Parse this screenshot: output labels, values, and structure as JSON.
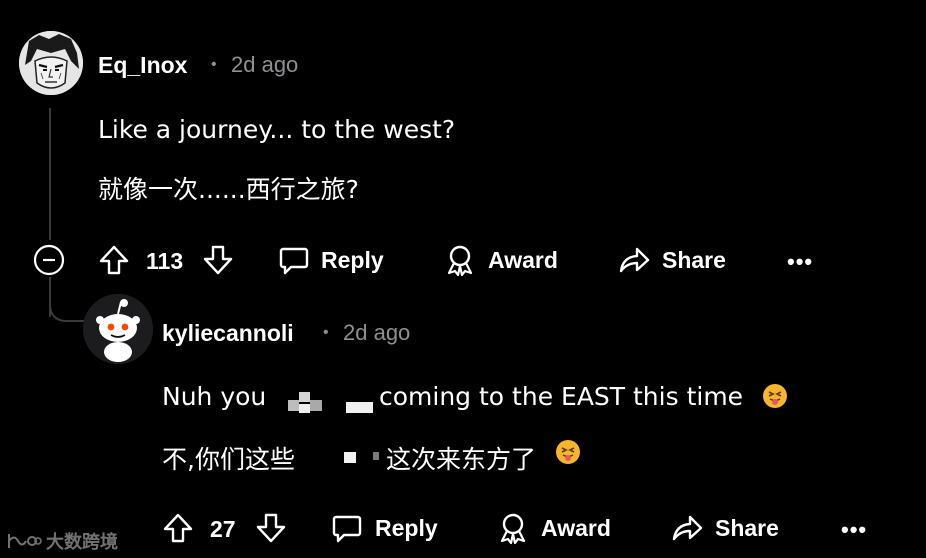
{
  "comment": {
    "username": "Eq_Inox",
    "separator": "•",
    "time": "2d ago",
    "line1": "Like a journey... to the west?",
    "line2": "就像一次......西行之旅?",
    "votes": "113",
    "reply_label": "Reply",
    "award_label": "Award",
    "share_label": "Share",
    "more_label": "•••"
  },
  "reply": {
    "username": "kyliecannoli",
    "separator": "•",
    "time": "2d ago",
    "line1_prefix": "Nuh you",
    "line1_suffix": "coming to the EAST this time",
    "line2_prefix": "不,你们这些",
    "line2_suffix": "这次来东方了",
    "votes": "27",
    "reply_label": "Reply",
    "award_label": "Award",
    "share_label": "Share",
    "more_label": "•••"
  },
  "watermark": {
    "text": "大数跨境"
  },
  "colors": {
    "background": "#000000",
    "text": "#ffffff",
    "meta": "#8e8e93",
    "thread_line": "#3a3a3c",
    "emoji": "#f7b52c"
  }
}
